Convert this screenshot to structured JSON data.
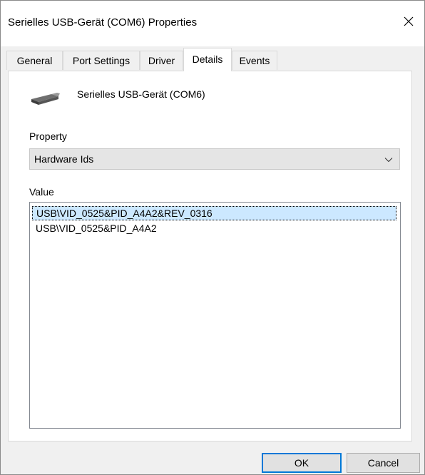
{
  "window": {
    "title": "Serielles USB-Gerät (COM6) Properties",
    "close_icon": "close-icon"
  },
  "tabs": [
    {
      "label": "General",
      "active": false
    },
    {
      "label": "Port Settings",
      "active": false
    },
    {
      "label": "Driver",
      "active": false
    },
    {
      "label": "Details",
      "active": true
    },
    {
      "label": "Events",
      "active": false
    }
  ],
  "details": {
    "device_icon": "usb-serial-device-icon",
    "device_name": "Serielles USB-Gerät (COM6)",
    "property_label": "Property",
    "property_selected": "Hardware Ids",
    "value_label": "Value",
    "values": [
      "USB\\VID_0525&PID_A4A2&REV_0316",
      "USB\\VID_0525&PID_A4A2"
    ],
    "selected_value_index": 0
  },
  "buttons": {
    "ok_label": "OK",
    "cancel_label": "Cancel"
  },
  "colors": {
    "selection": "#cce8ff",
    "default_button_border": "#0078d7",
    "window_background": "#f0f0f0"
  }
}
